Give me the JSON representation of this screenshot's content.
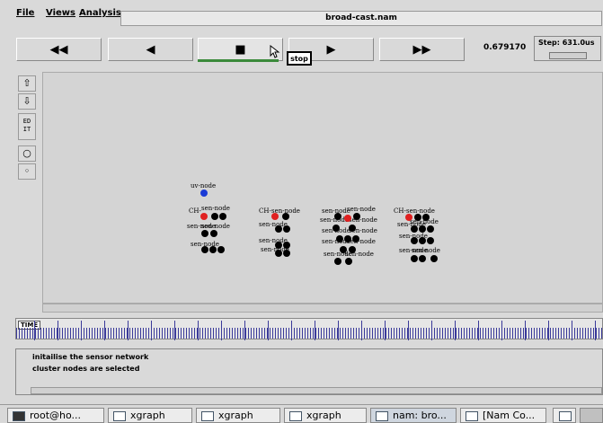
{
  "menu": {
    "file": "File",
    "views": "Views",
    "analysis": "Analysis"
  },
  "window_title": "broad-cast.nam",
  "controls": {
    "rewind": "◀◀",
    "back": "◀",
    "stop": "■",
    "play": "▶",
    "ffwd": "▶▶",
    "tooltip": "stop",
    "time": "0.679170",
    "step_label": "Step: 631.0us"
  },
  "left_tools": {
    "zoom_in": "⇧",
    "zoom_out": "⇩",
    "edit": "ED IT"
  },
  "canvas": {
    "uv_label": "uv-node",
    "ch_label": "CH-",
    "sen_label": "sen-node",
    "colors": {
      "uv": "#1a3bd6",
      "ch": "#e02020",
      "sensor": "#000000"
    }
  },
  "timeline": {
    "label": "TIME"
  },
  "log": {
    "line1": "initailise the sensor network",
    "line2": "cluster nodes are selected"
  },
  "taskbar": {
    "items": [
      {
        "label": "root@ho...",
        "icon": "terminal-icon"
      },
      {
        "label": "xgraph",
        "icon": "window-icon"
      },
      {
        "label": "xgraph",
        "icon": "window-icon"
      },
      {
        "label": "xgraph",
        "icon": "window-icon"
      },
      {
        "label": "nam: bro...",
        "icon": "window-icon"
      },
      {
        "label": "[Nam Co...",
        "icon": "window-icon"
      }
    ]
  }
}
